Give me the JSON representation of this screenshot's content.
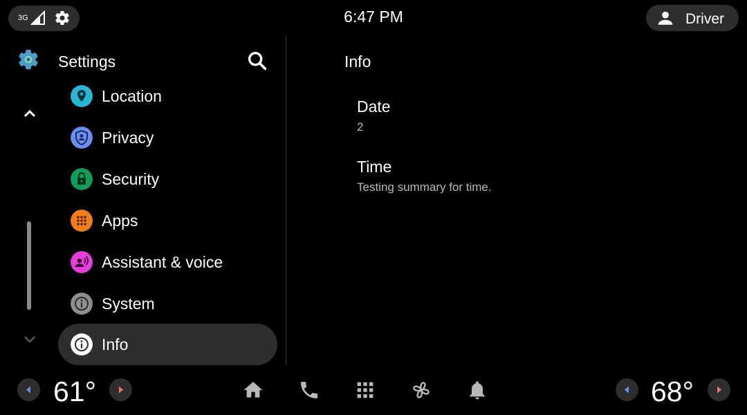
{
  "status_bar": {
    "network": "3G",
    "time": "6:47 PM",
    "user": "Driver"
  },
  "settings": {
    "title": "Settings",
    "menu": [
      {
        "label": "Location",
        "icon": "location-icon",
        "color": "#29b6d2"
      },
      {
        "label": "Privacy",
        "icon": "privacy-icon",
        "color": "#6a8ff0"
      },
      {
        "label": "Security",
        "icon": "lock-icon",
        "color": "#0f9d58"
      },
      {
        "label": "Apps",
        "icon": "apps-grid-icon",
        "color": "#f27d1b"
      },
      {
        "label": "Assistant & voice",
        "icon": "assistant-voice-icon",
        "color": "#e63ddb"
      },
      {
        "label": "System",
        "icon": "info-icon",
        "color": "#8f8f8f"
      },
      {
        "label": "Info",
        "icon": "info-icon",
        "color": "#ffffff"
      }
    ],
    "selected": "Info"
  },
  "panel": {
    "title": "Info",
    "prefs": [
      {
        "title": "Date",
        "summary": "2"
      },
      {
        "title": "Time",
        "summary": "Testing summary for time."
      }
    ]
  },
  "climate": {
    "left_temp": "61°",
    "right_temp": "68°",
    "left_arrow_color": "#6a8ff0",
    "right_arrow_color": "#f0726a"
  },
  "nav": [
    "home-icon",
    "phone-icon",
    "app-grid-icon",
    "fan-icon",
    "bell-icon"
  ]
}
